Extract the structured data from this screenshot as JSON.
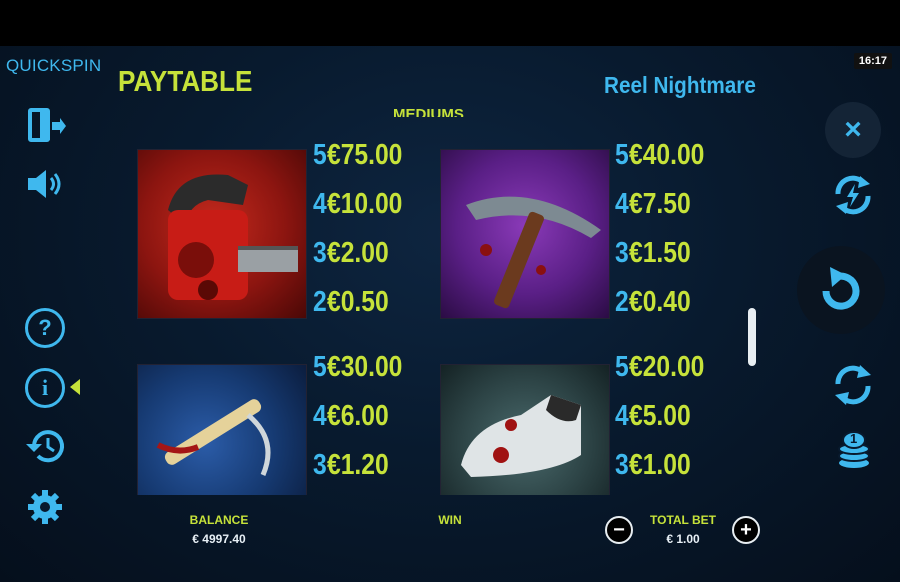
{
  "header": {
    "brand": "QUICKSPIN",
    "clock": "16:17",
    "title": "PAYTABLE",
    "game_name": "Reel Nightmare",
    "section": "MEDIUMS"
  },
  "left_menu": {
    "icons": [
      "exit-icon",
      "sound-icon",
      "help-icon",
      "info-icon",
      "history-icon",
      "settings-icon"
    ],
    "help_glyph": "?",
    "info_glyph": "i"
  },
  "right_menu": {
    "close_glyph": "×",
    "icons": [
      "close-icon",
      "turbo-icon",
      "spin-icon",
      "autoplay-icon",
      "coin-stack-icon"
    ],
    "coin_badge": "1"
  },
  "paytable": [
    {
      "symbol": "chainsaw",
      "rows": [
        {
          "count": "5",
          "amount": "€75.00"
        },
        {
          "count": "4",
          "amount": "€10.00"
        },
        {
          "count": "3",
          "amount": "€2.00"
        },
        {
          "count": "2",
          "amount": "€0.50"
        }
      ]
    },
    {
      "symbol": "pickaxe",
      "rows": [
        {
          "count": "5",
          "amount": "€40.00"
        },
        {
          "count": "4",
          "amount": "€7.50"
        },
        {
          "count": "3",
          "amount": "€1.50"
        },
        {
          "count": "2",
          "amount": "€0.40"
        }
      ]
    },
    {
      "symbol": "hacksaw",
      "rows": [
        {
          "count": "5",
          "amount": "€30.00"
        },
        {
          "count": "4",
          "amount": "€6.00"
        },
        {
          "count": "3",
          "amount": "€1.20"
        }
      ]
    },
    {
      "symbol": "bloody-sneaker",
      "rows": [
        {
          "count": "5",
          "amount": "€20.00"
        },
        {
          "count": "4",
          "amount": "€5.00"
        },
        {
          "count": "3",
          "amount": "€1.00"
        }
      ]
    }
  ],
  "footer": {
    "balance_label": "BALANCE",
    "balance_value": "€ 4997.40",
    "win_label": "WIN",
    "total_bet_label": "TOTAL BET",
    "total_bet_value": "€ 1.00",
    "minus": "−",
    "plus": "+"
  },
  "colors": {
    "accent_blue": "#3fb8ee",
    "accent_lime": "#c6e23a"
  }
}
